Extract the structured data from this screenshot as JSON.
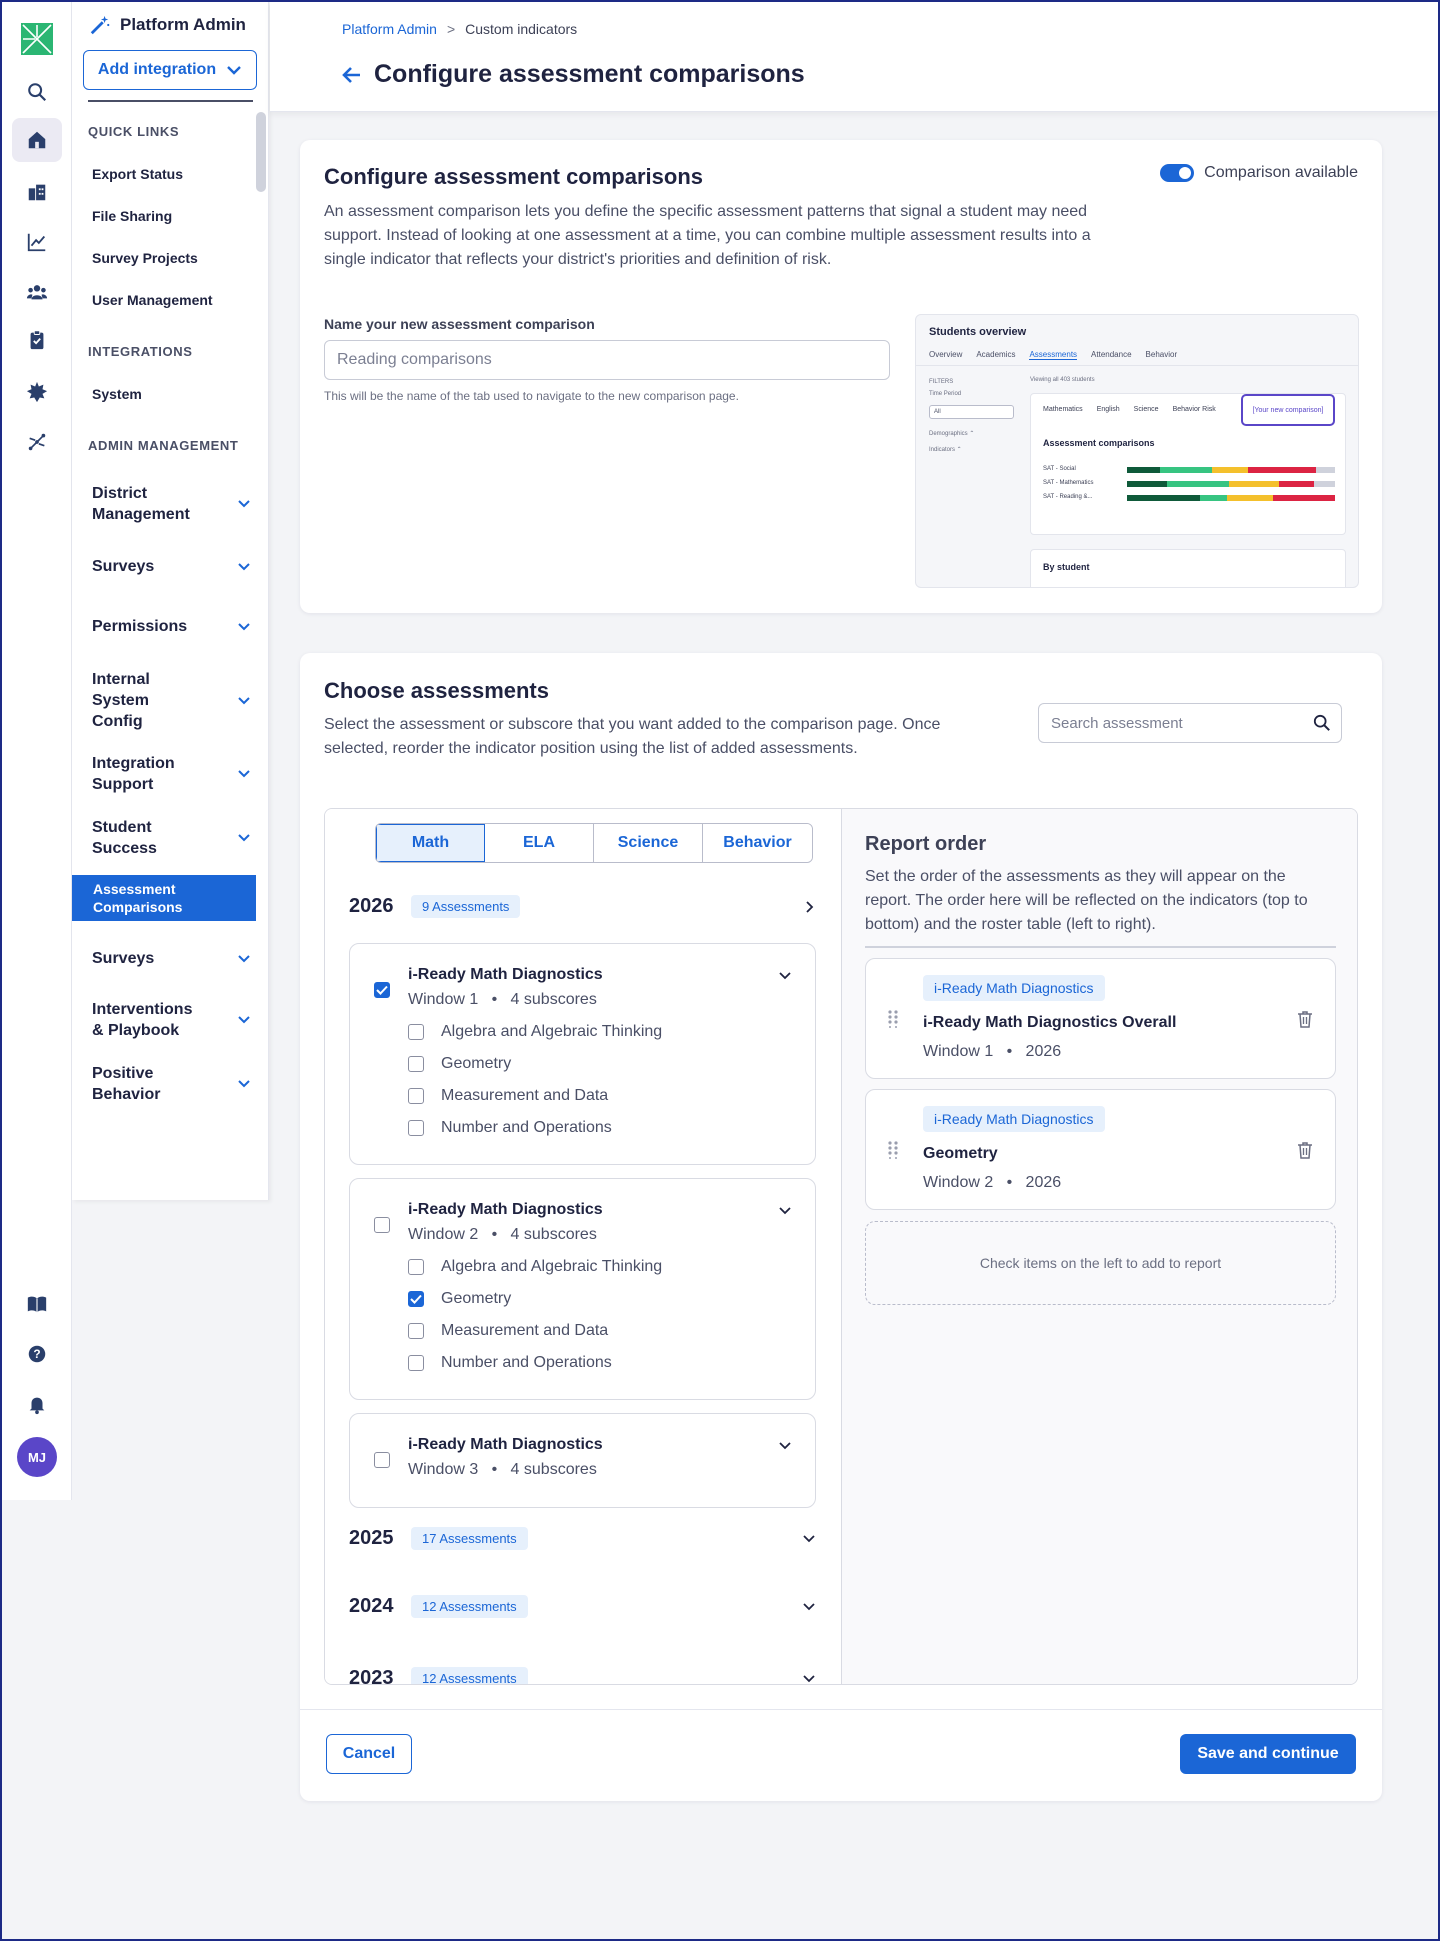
{
  "sidenav": {
    "title": "Platform Admin",
    "add_integration": "Add integration",
    "quick_links_heading": "QUICK LINKS",
    "quick_links": [
      "Export Status",
      "File Sharing",
      "Survey Projects",
      "User Management"
    ],
    "integrations_heading": "INTEGRATIONS",
    "integrations": [
      "System"
    ],
    "admin_heading": "ADMIN MANAGEMENT",
    "groups": [
      "District Management",
      "Surveys",
      "Permissions",
      "Internal System Config",
      "Integration Support",
      "Student Success"
    ],
    "active_item": "Assessment Comparisons",
    "groups_after": [
      "Surveys",
      "Interventions & Playbook",
      "Positive Behavior"
    ]
  },
  "rail": {
    "icons": [
      "logo-icon",
      "search-icon",
      "home-icon",
      "buildings-icon",
      "chart-icon",
      "people-icon",
      "clipboard-icon",
      "gear-burst-icon",
      "network-icon",
      "book-icon",
      "help-icon",
      "bell-icon"
    ],
    "avatar_initials": "MJ"
  },
  "header": {
    "breadcrumb": [
      "Platform Admin",
      "Custom indicators"
    ],
    "breadcrumb_sep": ">",
    "title": "Configure assessment comparisons"
  },
  "configure": {
    "title": "Configure assessment comparisons",
    "toggle_label": "Comparison available",
    "toggle_on": true,
    "description": "An assessment comparison lets you define the specific assessment patterns that signal a student may need support. Instead of looking at one assessment at a time, you can combine multiple assessment results into a single indicator that reflects your district's priorities and definition of risk.",
    "name_label": "Name your new assessment comparison",
    "name_placeholder": "Reading comparisons",
    "name_help": "This will be the name of the tab used to navigate to the new comparison page.",
    "preview": {
      "title": "Students overview",
      "tabs": [
        "Overview",
        "Academics",
        "Assessments",
        "Attendance",
        "Behavior"
      ],
      "filters": "FILTERS",
      "time_period": "Time Period",
      "time_value": "All",
      "demographics": "Demographics ⌃",
      "indicators": "Indicators ⌃",
      "count": "Viewing all 403 students",
      "subtabs": [
        "Mathematics",
        "English",
        "Science",
        "Behavior Risk"
      ],
      "highlight": "[Your new comparison]",
      "box_title": "Assessment comparisons",
      "rows": [
        "SAT - Social",
        "SAT - Mathematics",
        "SAT - Reading &..."
      ],
      "by_student": "By student"
    }
  },
  "choose": {
    "title": "Choose assessments",
    "description": "Select the assessment or subscore that you want added to the comparison page. Once selected, reorder the indicator position using the list of added assessments.",
    "search_placeholder": "Search assessment",
    "subjects": [
      "Math",
      "ELA",
      "Science",
      "Behavior"
    ],
    "active_subject": "Math",
    "years": [
      {
        "year": "2026",
        "count": "9 Assessments",
        "expanded": true
      },
      {
        "year": "2025",
        "count": "17 Assessments",
        "expanded": false
      },
      {
        "year": "2024",
        "count": "12 Assessments",
        "expanded": false
      },
      {
        "year": "2023",
        "count": "12 Assessments",
        "expanded": false
      }
    ],
    "assessments": [
      {
        "name": "i-Ready Math Diagnostics",
        "window": "Window 1",
        "subscores": "4 subscores",
        "checked": true,
        "items": [
          {
            "label": "Algebra and Algebraic Thinking",
            "checked": false
          },
          {
            "label": "Geometry",
            "checked": false
          },
          {
            "label": "Measurement and Data",
            "checked": false
          },
          {
            "label": "Number and Operations",
            "checked": false
          }
        ]
      },
      {
        "name": "i-Ready Math Diagnostics",
        "window": "Window 2",
        "subscores": "4 subscores",
        "checked": false,
        "items": [
          {
            "label": "Algebra and Algebraic Thinking",
            "checked": false
          },
          {
            "label": "Geometry",
            "checked": true
          },
          {
            "label": "Measurement and Data",
            "checked": false
          },
          {
            "label": "Number and Operations",
            "checked": false
          }
        ]
      },
      {
        "name": "i-Ready Math Diagnostics",
        "window": "Window 3",
        "subscores": "4 subscores",
        "checked": false,
        "items": []
      }
    ],
    "bullet": "•"
  },
  "report_order": {
    "title": "Report order",
    "description": "Set the order of the assessments as they will appear on the report. The order here will be reflected on the indicators (top to bottom) and the roster table (left to right).",
    "items": [
      {
        "tag": "i-Ready Math Diagnostics",
        "name": "i-Ready Math Diagnostics Overall",
        "window": "Window 1",
        "year": "2026"
      },
      {
        "tag": "i-Ready Math Diagnostics",
        "name": "Geometry",
        "window": "Window 2",
        "year": "2026"
      }
    ],
    "empty_hint": "Check items on the left to add to report"
  },
  "footer": {
    "cancel": "Cancel",
    "save": "Save and continue"
  },
  "colors": {
    "primary": "#1b66d6",
    "accent_purple": "#5a46c8",
    "text": "#1f2340"
  }
}
